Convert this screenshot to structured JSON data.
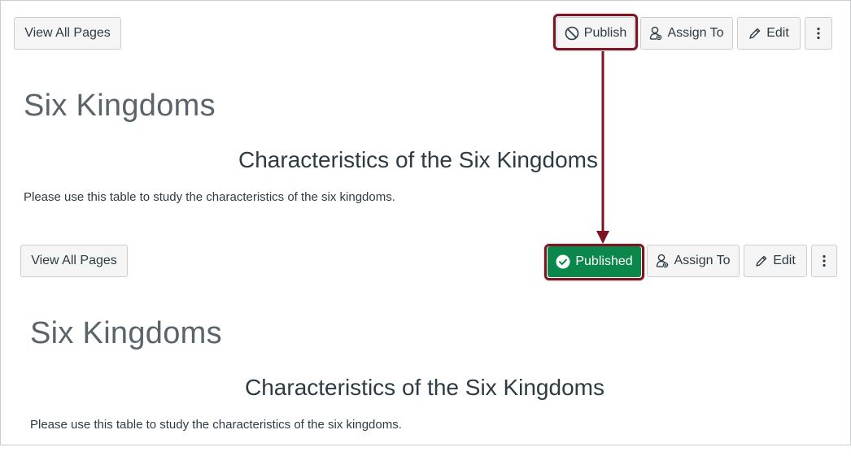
{
  "colors": {
    "published_green": "#0b874b",
    "highlight_red": "#7d1422",
    "button_bg": "#f5f5f5",
    "text_dark": "#2d3b45",
    "title_gray": "#5a646b"
  },
  "top": {
    "toolbar": {
      "view_all_label": "View All Pages",
      "publish_label": "Publish",
      "publish_icon": "unpublished-circle-slash-icon",
      "assign_label": "Assign To",
      "assign_icon": "assign-user-icon",
      "edit_label": "Edit",
      "edit_icon": "pencil-icon",
      "more_icon": "vertical-ellipsis-icon"
    },
    "page_title": "Six Kingdoms",
    "heading": "Characteristics of the Six Kingdoms",
    "body": "Please use this table to study the characteristics of the six kingdoms."
  },
  "bottom": {
    "toolbar": {
      "view_all_label": "View All Pages",
      "published_label": "Published",
      "published_icon": "check-circle-icon",
      "assign_label": "Assign To",
      "assign_icon": "assign-user-icon",
      "edit_label": "Edit",
      "edit_icon": "pencil-icon",
      "more_icon": "vertical-ellipsis-icon"
    },
    "page_title": "Six Kingdoms",
    "heading": "Characteristics of the Six Kingdoms",
    "body": "Please use this table to study the characteristics of the six kingdoms."
  }
}
